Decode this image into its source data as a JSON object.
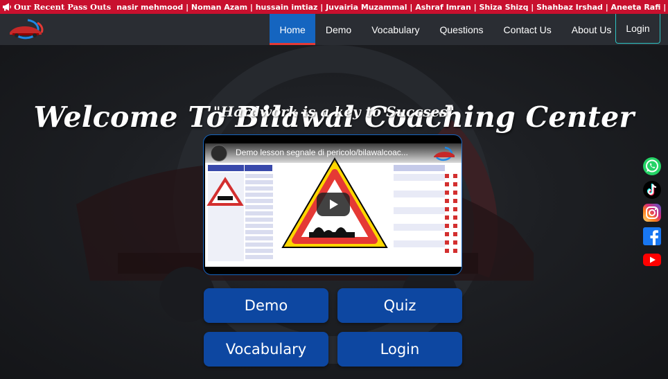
{
  "ticker": {
    "label": "Our Recent Pass Outs",
    "names": "nasir mehmood | Noman Azam | hussain imtiaz | Juvairia Muzammal | Ashraf Imran | Shiza Shizq | Shahbaz Irshad | Aneeta Rafi | Aleena Shakoor | Ajmal"
  },
  "nav": {
    "items": [
      {
        "label": "Home",
        "active": true
      },
      {
        "label": "Demo"
      },
      {
        "label": "Vocabulary"
      },
      {
        "label": "Questions"
      },
      {
        "label": "Contact Us"
      },
      {
        "label": "About Us"
      }
    ],
    "login": "Login"
  },
  "hero": {
    "title": "Welcome To Bilawal Coaching Center",
    "subtitle": "\"Hardwork is a key to Succses\""
  },
  "video": {
    "title": "Demo lesson segnale di pericolo/bilawalcoac..."
  },
  "buttons": {
    "demo": "Demo",
    "quiz": "Quiz",
    "vocabulary": "Vocabulary",
    "login": "Login"
  },
  "social": [
    "whatsapp-icon",
    "tiktok-icon",
    "instagram-icon",
    "facebook-icon",
    "youtube-icon"
  ],
  "colors": {
    "ticker_bg": "#c8102e",
    "navbar_bg": "#2a2d33",
    "nav_active": "#1565c0",
    "button_bg": "#0d47a1"
  }
}
